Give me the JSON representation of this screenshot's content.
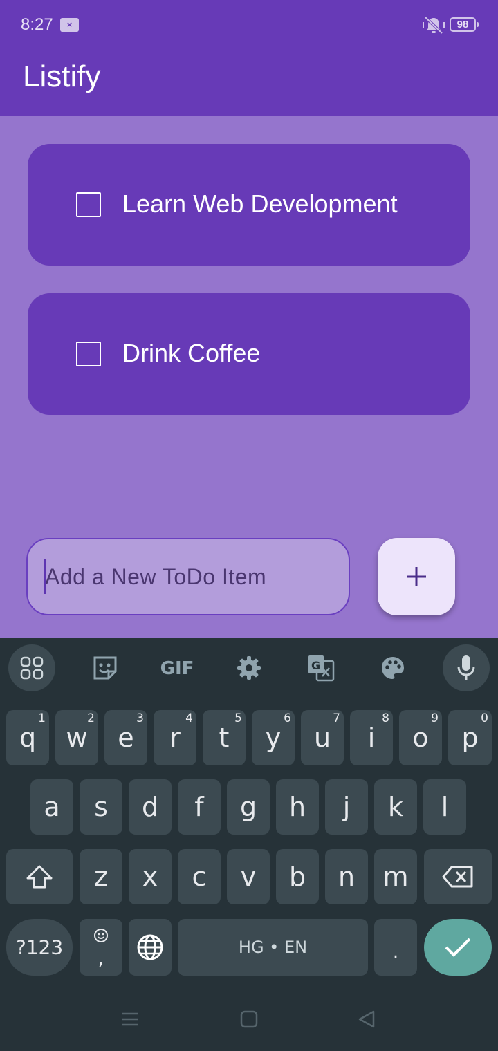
{
  "status_bar": {
    "time": "8:27",
    "notif_badge": "×",
    "battery": "98"
  },
  "app": {
    "title": "Listify"
  },
  "todos": [
    {
      "label": "Learn Web Development",
      "checked": false
    },
    {
      "label": "Drink Coffee",
      "checked": false
    }
  ],
  "new_item": {
    "placeholder": "Add a New ToDo Item",
    "value": ""
  },
  "add_button": {
    "icon": "plus-icon"
  },
  "keyboard": {
    "toolbar": [
      "apps-grid-icon",
      "sticker-icon",
      "gif-icon",
      "settings-icon",
      "translate-icon",
      "palette-icon",
      "mic-icon"
    ],
    "gif_label": "GIF",
    "row1": [
      {
        "key": "q",
        "hint": "1"
      },
      {
        "key": "w",
        "hint": "2"
      },
      {
        "key": "e",
        "hint": "3"
      },
      {
        "key": "r",
        "hint": "4"
      },
      {
        "key": "t",
        "hint": "5"
      },
      {
        "key": "y",
        "hint": "6"
      },
      {
        "key": "u",
        "hint": "7"
      },
      {
        "key": "i",
        "hint": "8"
      },
      {
        "key": "o",
        "hint": "9"
      },
      {
        "key": "p",
        "hint": "0"
      }
    ],
    "row2": [
      "a",
      "s",
      "d",
      "f",
      "g",
      "h",
      "j",
      "k",
      "l"
    ],
    "row3": [
      "z",
      "x",
      "c",
      "v",
      "b",
      "n",
      "m"
    ],
    "symbols_label": "?123",
    "emoji_comma": ",",
    "space_label": "HG • EN",
    "period": "."
  },
  "colors": {
    "primary": "#673ab7",
    "background": "#9575cd",
    "keyboard": "#263238",
    "key": "#3c4a51",
    "done_key": "#5fa8a0"
  }
}
